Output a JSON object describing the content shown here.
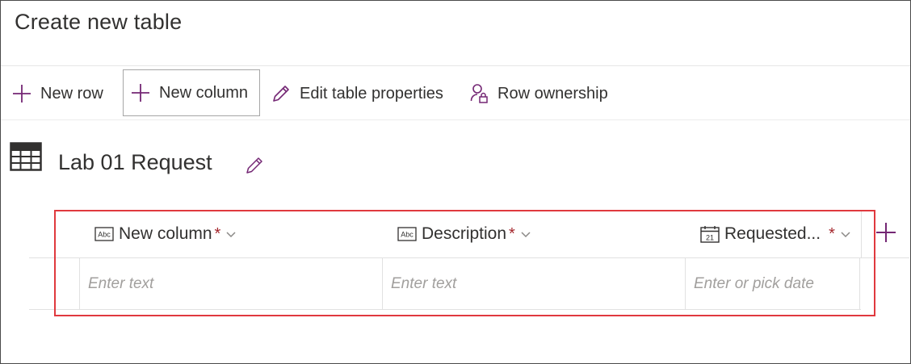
{
  "page": {
    "title": "Create new table"
  },
  "toolbar": {
    "new_row": "New row",
    "new_column": "New column",
    "edit_properties": "Edit table properties",
    "row_ownership": "Row ownership"
  },
  "table": {
    "name": "Lab 01 Request"
  },
  "columns": [
    {
      "label": "New column",
      "type_icon": "text-field-icon",
      "required_mark": "*",
      "placeholder": "Enter text"
    },
    {
      "label": "Description",
      "type_icon": "text-field-icon",
      "required_mark": "*",
      "placeholder": "Enter text"
    },
    {
      "label": "Requested...",
      "type_icon": "calendar-icon",
      "required_mark": "*",
      "placeholder": "Enter or pick date"
    }
  ],
  "colors": {
    "accent": "#742774",
    "required": "#a4262c",
    "highlight": "#e0393e"
  }
}
